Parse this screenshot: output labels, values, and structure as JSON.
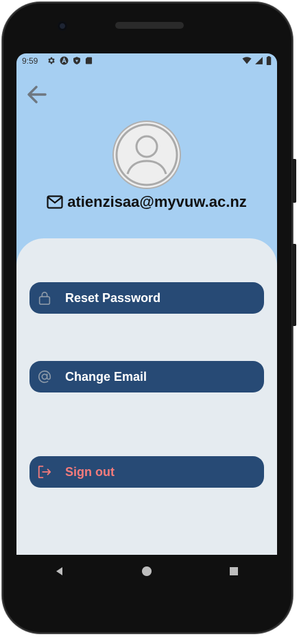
{
  "status_bar": {
    "time": "9:59",
    "left_icons": [
      "gear-icon",
      "a-circle-icon",
      "shield-icon",
      "sd-card-icon"
    ],
    "right_icons": [
      "wifi-icon",
      "cell-signal-icon",
      "battery-icon"
    ]
  },
  "header": {
    "back_icon": "back-arrow-icon",
    "avatar_icon": "user-avatar-icon",
    "email_icon": "mail-icon",
    "email": "atienzisaa@myvuw.ac.nz"
  },
  "actions": [
    {
      "label": "Reset Password",
      "icon": "lock-icon"
    },
    {
      "label": "Change Email",
      "icon": "at-icon"
    },
    {
      "label": "Sign out",
      "icon": "sign-out-icon"
    }
  ],
  "nav": {
    "back": "nav-back-icon",
    "home": "nav-home-icon",
    "recents": "nav-recents-icon"
  },
  "colors": {
    "header_bg": "#a6cff2",
    "panel_bg": "#e5ebf0",
    "button_bg": "#274a75",
    "button_text": "#ffffff",
    "signout_text": "#f47b7b"
  }
}
